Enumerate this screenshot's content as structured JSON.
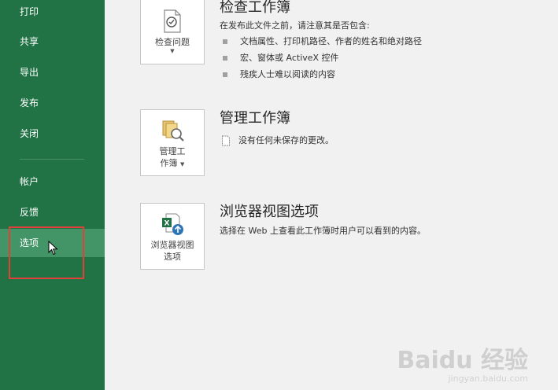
{
  "sidebar": {
    "items": [
      {
        "label": "打印"
      },
      {
        "label": "共享"
      },
      {
        "label": "导出"
      },
      {
        "label": "发布"
      },
      {
        "label": "关闭"
      },
      {
        "label": "帐户"
      },
      {
        "label": "反馈"
      },
      {
        "label": "选项"
      }
    ]
  },
  "inspect": {
    "tile_label": "检查问题",
    "title": "检查工作簿",
    "desc": "在发布此文件之前，请注意其是否包含:",
    "bullets": [
      "文档属性、打印机路径、作者的姓名和绝对路径",
      "宏、窗体或 ActiveX 控件",
      "残疾人士难以阅读的内容"
    ]
  },
  "manage": {
    "tile_label_1": "管理工",
    "tile_label_2": "作簿",
    "title": "管理工作簿",
    "status": "没有任何未保存的更改。"
  },
  "browser": {
    "tile_label_1": "浏览器视图",
    "tile_label_2": "选项",
    "title": "浏览器视图选项",
    "desc": "选择在 Web 上查看此工作簿时用户可以看到的内容。"
  },
  "watermark": {
    "logo": "Baidu 经验",
    "sub": "jingyan.baidu.com"
  },
  "colors": {
    "sidebar": "#217346",
    "sidebar_hover": "#439467",
    "highlight": "#e3403a"
  }
}
